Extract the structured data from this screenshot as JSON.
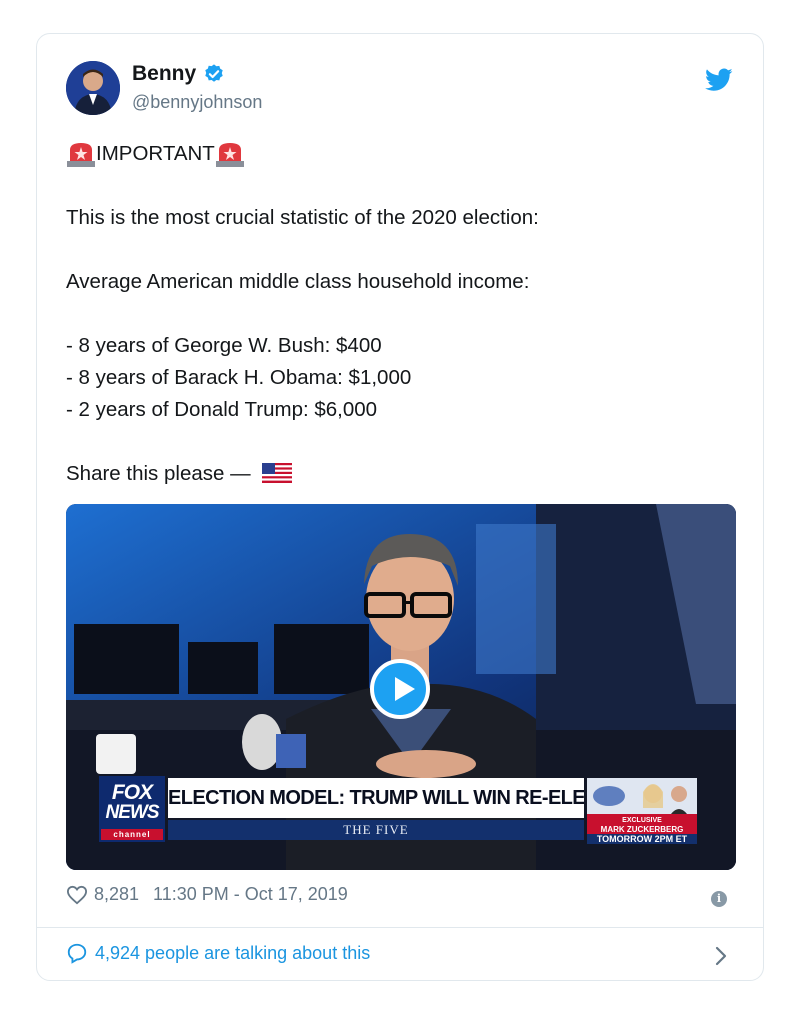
{
  "user": {
    "name": "Benny",
    "handle": "@bennyjohnson"
  },
  "tweet": {
    "important": "IMPORTANT",
    "line1": "This is the most crucial statistic of the 2020 election:",
    "line2": "Average American middle class household income:",
    "list": [
      "- 8 years of George W. Bush: $400",
      "- 8 years of Barack H. Obama: $1,000",
      "- 2 years of Donald Trump: $6,000"
    ],
    "share": "Share this please —"
  },
  "video": {
    "network_line1": "FOX",
    "network_line2": "NEWS",
    "network_line3": "channel",
    "headline": "ELECTION MODEL: TRUMP WILL WIN RE-ELECTION",
    "show": "THE FIVE",
    "promo_line1": "EXCLUSIVE",
    "promo_line2": "MARK ZUCKERBERG",
    "promo_line3": "TOMORROW 2PM ET"
  },
  "footer": {
    "likes": "8,281",
    "timestamp": "11:30 PM - Oct 17, 2019",
    "talking": "4,924 people are talking about this"
  },
  "icons": {
    "verified": "verified-badge-icon",
    "bird": "twitter-bird-icon",
    "heart": "heart-icon",
    "info": "info-icon",
    "bubble": "comment-bubble-icon",
    "chevron": "chevron-right-icon"
  },
  "colors": {
    "accent": "#1da1f2",
    "link": "#1b95e0",
    "muted": "#657786"
  }
}
